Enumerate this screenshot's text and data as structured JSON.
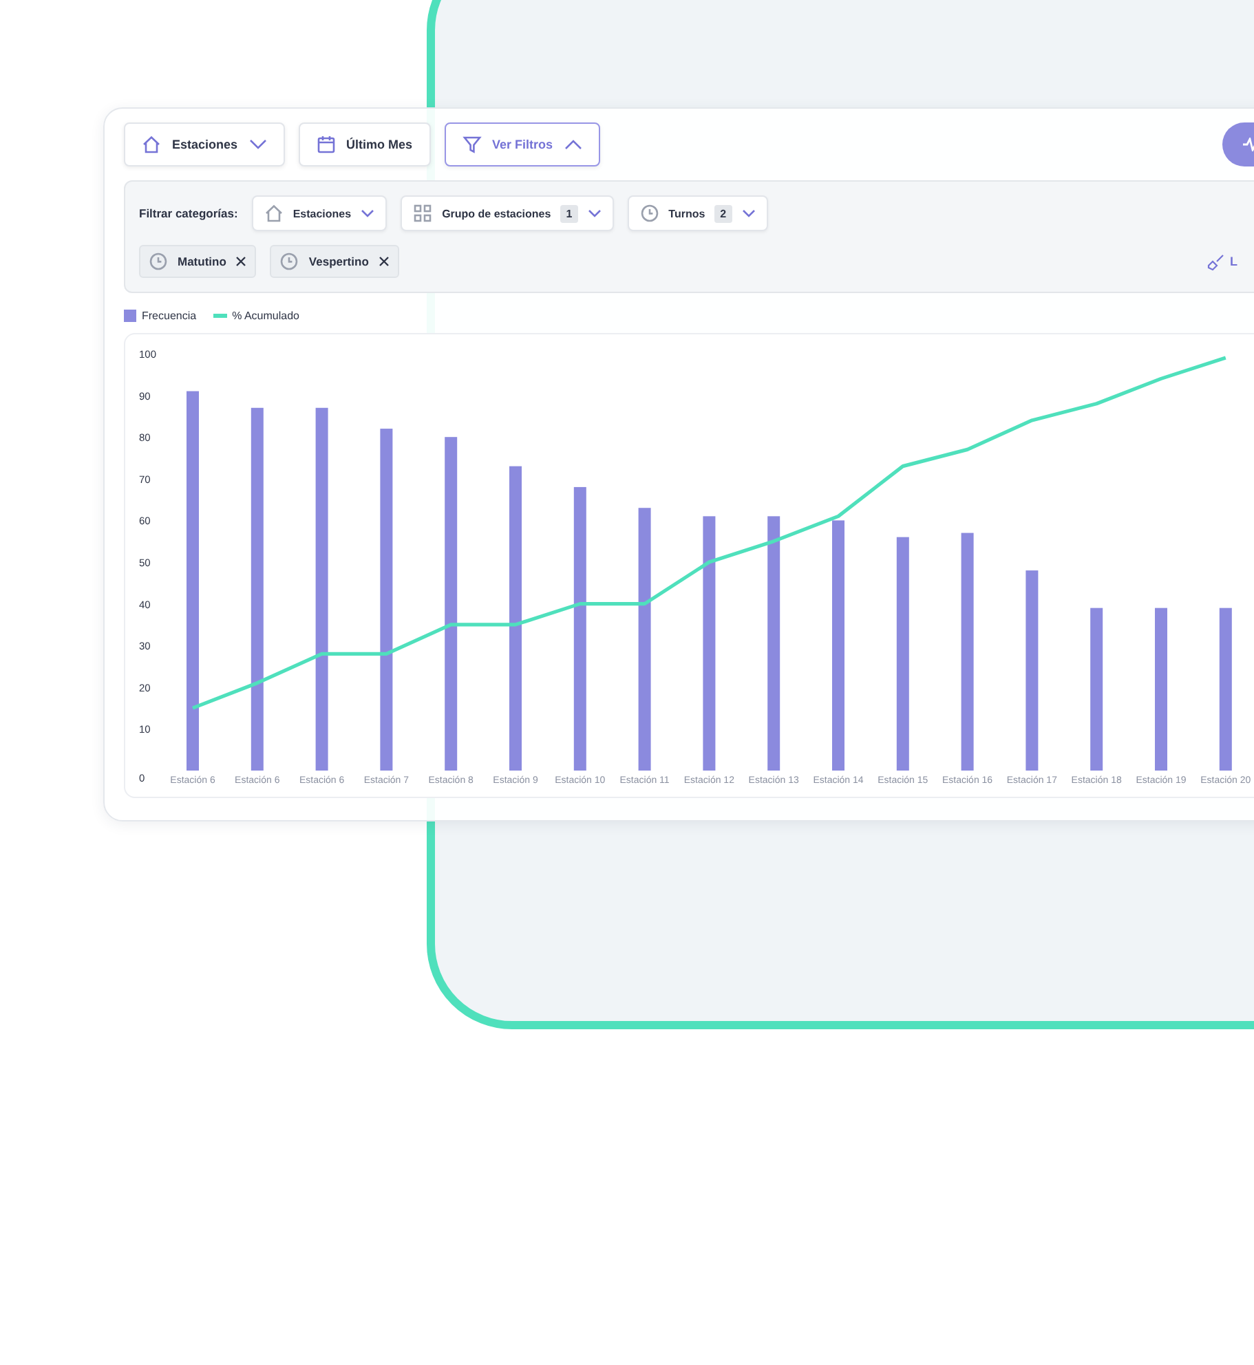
{
  "toolbar": {
    "buttons": [
      {
        "label": "Estaciones",
        "selected": false
      },
      {
        "label": "Último Mes",
        "selected": false
      },
      {
        "label": "Ver Filtros",
        "selected": true
      }
    ]
  },
  "filters": {
    "label": "Filtrar categorías:",
    "dropdowns": [
      {
        "label": "Estaciones"
      },
      {
        "label": "Grupo de estaciones",
        "count": "1"
      },
      {
        "label": "Turnos",
        "count": "2"
      }
    ],
    "chips": [
      {
        "label": "Matutino"
      },
      {
        "label": "Vespertino"
      }
    ],
    "clear_label": "L"
  },
  "chart_data": {
    "type": "bar",
    "categories": [
      "Estación 6",
      "Estación 6",
      "Estación 6",
      "Estación 7",
      "Estación 8",
      "Estación 9",
      "Estación 10",
      "Estación 11",
      "Estación 12",
      "Estación 13",
      "Estación 14",
      "Estación 15",
      "Estación 16",
      "Estación 17",
      "Estación 18",
      "Estación 19",
      "Estación 20"
    ],
    "series": [
      {
        "name": "Frecuencia",
        "color": "#8b8ade",
        "values": [
          91,
          87,
          87,
          82,
          80,
          73,
          68,
          63,
          61,
          61,
          60,
          56,
          57,
          48,
          39,
          39,
          39
        ]
      },
      {
        "name": "% Acumulado",
        "type": "line",
        "color": "#4fe0bc",
        "values": [
          15,
          21,
          28,
          28,
          35,
          35,
          40,
          40,
          50,
          55,
          61,
          73,
          77,
          84,
          88,
          94,
          99
        ]
      }
    ],
    "ylim": [
      0,
      100
    ],
    "yticks": [
      0,
      10,
      20,
      30,
      40,
      50,
      60,
      70,
      80,
      90,
      100
    ]
  }
}
